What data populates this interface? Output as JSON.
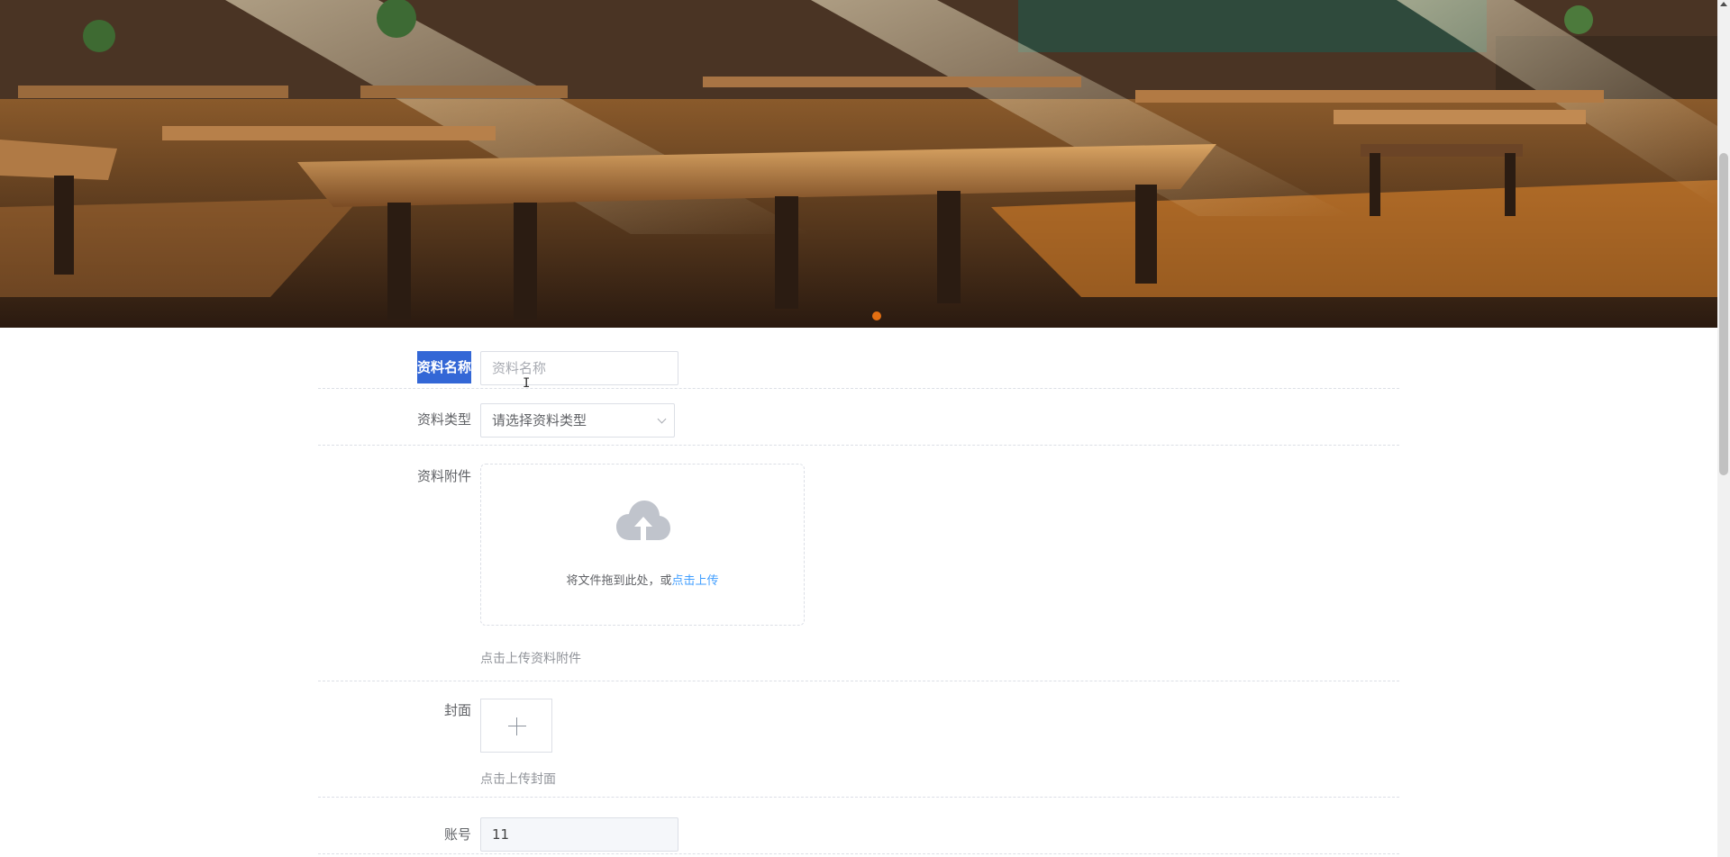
{
  "form": {
    "name": {
      "label": "资料名称",
      "placeholder": "资料名称"
    },
    "type": {
      "label": "资料类型",
      "placeholder": "请选择资料类型"
    },
    "attachment": {
      "label": "资料附件",
      "drag_text": "将文件拖到此处，或",
      "upload_link": "点击上传",
      "tip": "点击上传资料附件"
    },
    "cover": {
      "label": "封面",
      "tip": "点击上传封面"
    },
    "account": {
      "label": "账号",
      "value": "11"
    }
  },
  "colors": {
    "selection": "#3367d6",
    "link": "#409eff",
    "carousel_dot": "#e46f12"
  },
  "icons": [
    "upload-cloud-icon",
    "plus-icon",
    "chevron-down-icon"
  ]
}
